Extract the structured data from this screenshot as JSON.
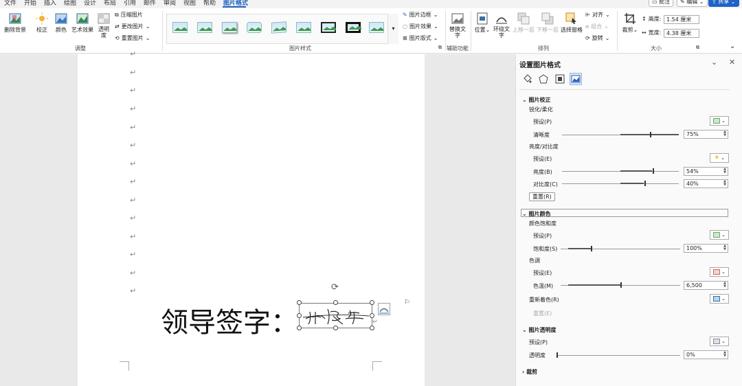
{
  "menu": {
    "items": [
      "文件",
      "开始",
      "插入",
      "绘图",
      "设计",
      "布局",
      "引用",
      "邮件",
      "审阅",
      "视图",
      "帮助",
      "图片格式"
    ],
    "comment_btn": "批注",
    "edit_btn": "编辑",
    "share_btn": "共享"
  },
  "ribbon": {
    "remove_bg": "删除背景",
    "corrections": "校正",
    "color": "颜色",
    "artistic": "艺术效果",
    "transparency": "透明度",
    "compress": "压缩图片",
    "change": "更改图片",
    "reset": "重置图片",
    "group_adjust": "调整",
    "border": "图片边框",
    "effects": "图片效果",
    "layout": "图片版式",
    "group_styles": "图片样式",
    "alt_text": "替换文字",
    "group_access": "辅助功能",
    "position": "位置",
    "wrap": "环绕文字",
    "forward": "上移一层",
    "backward": "下移一层",
    "selection_pane": "选择窗格",
    "align": "对齐",
    "group_obj": "组合",
    "rotate": "旋转",
    "group_arrange": "排列",
    "crop": "裁剪",
    "height_label": "高度:",
    "height_value": "1.54 厘米",
    "width_label": "宽度:",
    "width_value": "4.38 厘米",
    "group_size": "大小"
  },
  "document": {
    "signature_label": "领导签字：",
    "signature_text": "刘德华",
    "para_mark": "↵"
  },
  "pane": {
    "title": "设置图片格式",
    "correction_header": "图片校正",
    "sharpen_section": "锐化/柔化",
    "preset1": "预设(P)",
    "sharpness_label": "清晰度",
    "sharpness_value": "75%",
    "brightness_section": "亮度/对比度",
    "preset2": "预设(E)",
    "brightness_label": "亮度(B)",
    "brightness_value": "54%",
    "contrast_label": "对比度(C)",
    "contrast_value": "40%",
    "reset_label": "重置(R)",
    "color_header": "图片颜色",
    "saturation_section": "颜色饱和度",
    "preset3": "预设(P)",
    "saturation_label": "饱和度(S)",
    "saturation_value": "100%",
    "tone_section": "色调",
    "preset4": "预设(E)",
    "temperature_label": "色温(M)",
    "temperature_value": "6,500",
    "recolor_label": "重新着色(R)",
    "reset2_label": "重置(E)",
    "transparency_header": "图片透明度",
    "preset5": "预设(P)",
    "transparency_label": "透明度",
    "transparency_value": "0%",
    "crop_header": "裁剪"
  },
  "slider_levels": {
    "sharpness": 0.75,
    "brightness": 0.54,
    "contrast": 0.4,
    "saturation": 0.25,
    "temperature": 0.5,
    "transparency": 0.0
  }
}
